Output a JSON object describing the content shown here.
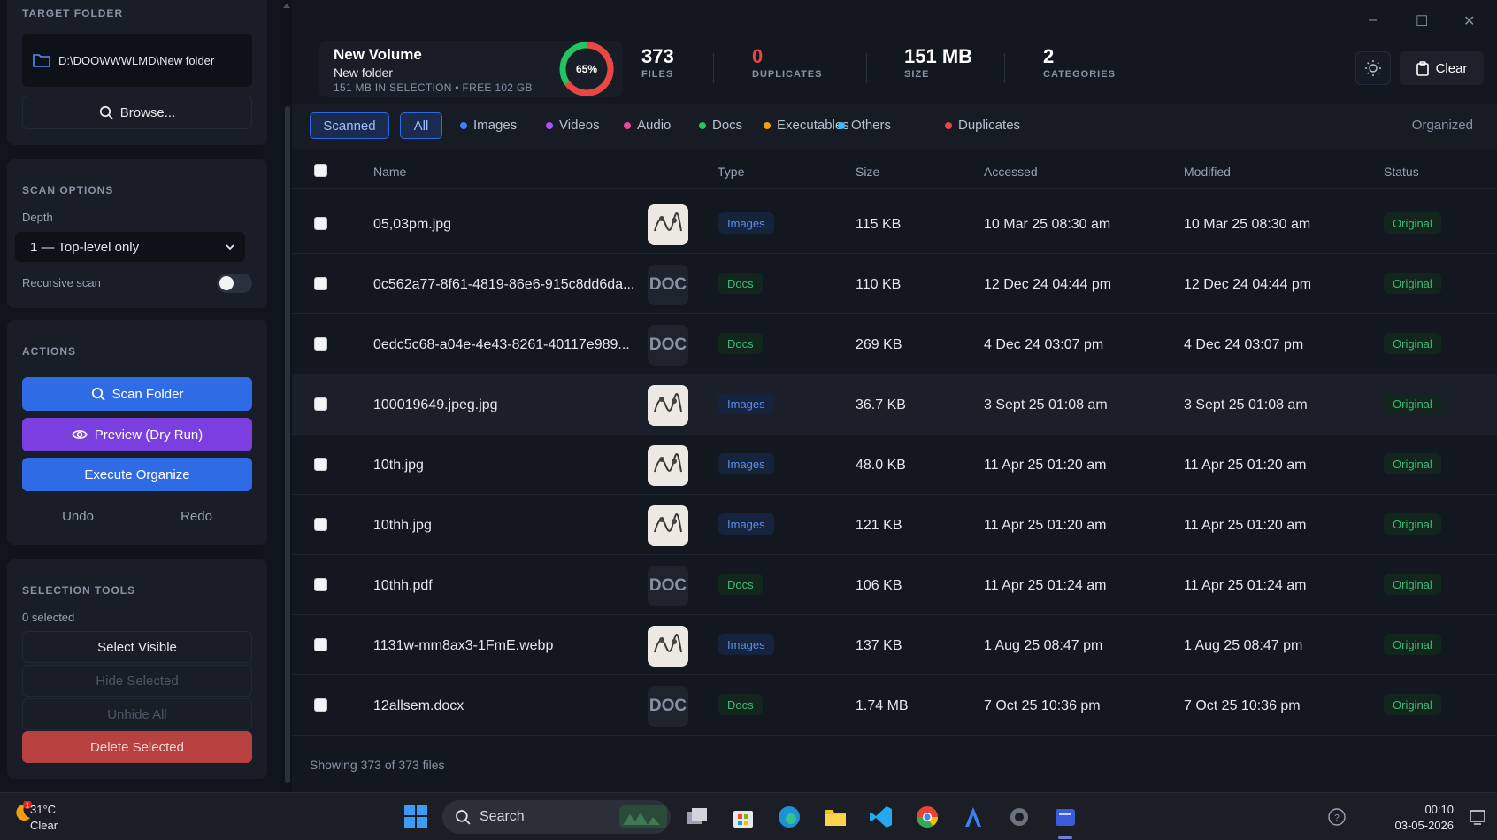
{
  "sidebar": {
    "target_folder": {
      "title": "TARGET FOLDER",
      "path": "D:\\DOOWWWLMD\\New folder",
      "browse_label": "Browse..."
    },
    "scan_options": {
      "title": "SCAN OPTIONS",
      "depth_label": "Depth",
      "depth_value": "1 — Top-level only",
      "recursive_label": "Recursive scan",
      "recursive_on": false
    },
    "actions": {
      "title": "ACTIONS",
      "scan": "Scan Folder",
      "preview": "Preview (Dry Run)",
      "execute": "Execute Organize",
      "undo": "Undo",
      "redo": "Redo"
    },
    "selection": {
      "title": "SELECTION TOOLS",
      "count": "0 selected",
      "select_visible": "Select Visible",
      "hide_selected": "Hide Selected",
      "unhide_all": "Unhide All",
      "delete_selected": "Delete Selected"
    }
  },
  "window_controls": {
    "minimize": "–",
    "maximize": "☐",
    "close": "✕"
  },
  "volume": {
    "title": "New Volume",
    "subtitle": "New folder",
    "meta": "151 MB IN SELECTION • FREE 102 GB",
    "used_percent": 65,
    "used_label": "65%"
  },
  "stats": [
    {
      "value": "373",
      "label": "FILES",
      "color": "#ffffff"
    },
    {
      "value": "0",
      "label": "DUPLICATES",
      "color": "#ef4444"
    },
    {
      "value": "151 MB",
      "label": "SIZE",
      "color": "#ffffff"
    },
    {
      "value": "2",
      "label": "CATEGORIES",
      "color": "#ffffff"
    }
  ],
  "toolbar": {
    "clear_label": "Clear",
    "theme_icon": "sun-icon"
  },
  "tabs": {
    "scanned": "Scanned",
    "all": "All",
    "organized": "Organized"
  },
  "filters": [
    {
      "label": "Images",
      "color": "#3b82f6"
    },
    {
      "label": "Videos",
      "color": "#a855f7"
    },
    {
      "label": "Audio",
      "color": "#ec4899"
    },
    {
      "label": "Docs",
      "color": "#22c55e"
    },
    {
      "label": "Executables",
      "color": "#f59e0b"
    },
    {
      "label": "Others",
      "color": "#38bdf8"
    },
    {
      "label": "Duplicates",
      "color": "#ef4444"
    }
  ],
  "table": {
    "columns": {
      "name": "Name",
      "type": "Type",
      "size": "Size",
      "accessed": "Accessed",
      "modified": "Modified",
      "status": "Status"
    },
    "rows": [
      {
        "name": "05,03pm.jpg",
        "thumb": "img",
        "type": "Images",
        "size": "115 KB",
        "accessed": "10 Mar 25 08:30 am",
        "modified": "10 Mar 25 08:30 am",
        "status": "Original"
      },
      {
        "name": "0c562a77-8f61-4819-86e6-915c8dd6da...",
        "thumb": "DOC",
        "type": "Docs",
        "size": "110 KB",
        "accessed": "12 Dec 24 04:44 pm",
        "modified": "12 Dec 24 04:44 pm",
        "status": "Original"
      },
      {
        "name": "0edc5c68-a04e-4e43-8261-40117e989...",
        "thumb": "DOC",
        "type": "Docs",
        "size": "269 KB",
        "accessed": "4 Dec 24 03:07 pm",
        "modified": "4 Dec 24 03:07 pm",
        "status": "Original"
      },
      {
        "name": "100019649.jpeg.jpg",
        "thumb": "img",
        "type": "Images",
        "size": "36.7 KB",
        "accessed": "3 Sept 25 01:08 am",
        "modified": "3 Sept 25 01:08 am",
        "status": "Original"
      },
      {
        "name": "10th.jpg",
        "thumb": "img",
        "type": "Images",
        "size": "48.0 KB",
        "accessed": "11 Apr 25 01:20 am",
        "modified": "11 Apr 25 01:20 am",
        "status": "Original"
      },
      {
        "name": "10thh.jpg",
        "thumb": "img",
        "type": "Images",
        "size": "121 KB",
        "accessed": "11 Apr 25 01:20 am",
        "modified": "11 Apr 25 01:20 am",
        "status": "Original"
      },
      {
        "name": "10thh.pdf",
        "thumb": "DOC",
        "type": "Docs",
        "size": "106 KB",
        "accessed": "11 Apr 25 01:24 am",
        "modified": "11 Apr 25 01:24 am",
        "status": "Original"
      },
      {
        "name": "1131w-mm8ax3-1FmE.webp",
        "thumb": "img",
        "type": "Images",
        "size": "137 KB",
        "accessed": "1 Aug 25 08:47 pm",
        "modified": "1 Aug 25 08:47 pm",
        "status": "Original"
      },
      {
        "name": "12allsem.docx",
        "thumb": "DOC",
        "type": "Docs",
        "size": "1.74 MB",
        "accessed": "7 Oct 25 10:36 pm",
        "modified": "7 Oct 25 10:36 pm",
        "status": "Original"
      }
    ],
    "footer": "Showing 373 of 373 files"
  },
  "taskbar": {
    "temp": "31°C",
    "condition": "Clear",
    "weather_badge": "1",
    "search_label": "Search",
    "time": "00:10",
    "date": "03-05-2026"
  }
}
